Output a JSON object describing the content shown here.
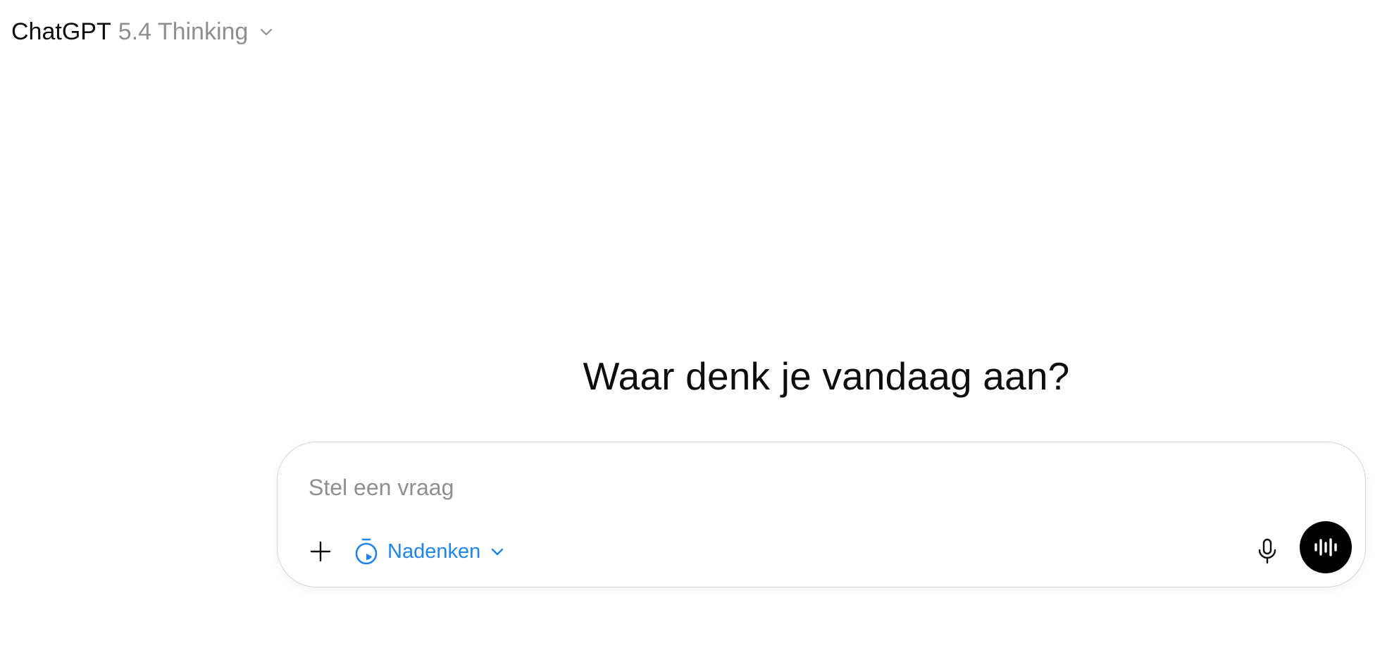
{
  "header": {
    "model_name": "ChatGPT",
    "model_version": "5.4 Thinking"
  },
  "main": {
    "headline": "Waar denk je vandaag aan?"
  },
  "composer": {
    "placeholder": "Stel een vraag",
    "value": "",
    "mode_label": "Nadenken"
  },
  "colors": {
    "accent": "#1f84ec",
    "text_primary": "#0d0d0d",
    "text_secondary": "#8f8f8f",
    "voice_button_bg": "#000000",
    "composer_border": "#d6d6d6"
  },
  "icons": {
    "model_chevron": "chevron-down-icon",
    "add": "plus-icon",
    "mode": "stopwatch-icon",
    "mode_chevron": "chevron-down-icon",
    "dictate": "microphone-icon",
    "voice": "voice-wave-icon"
  }
}
